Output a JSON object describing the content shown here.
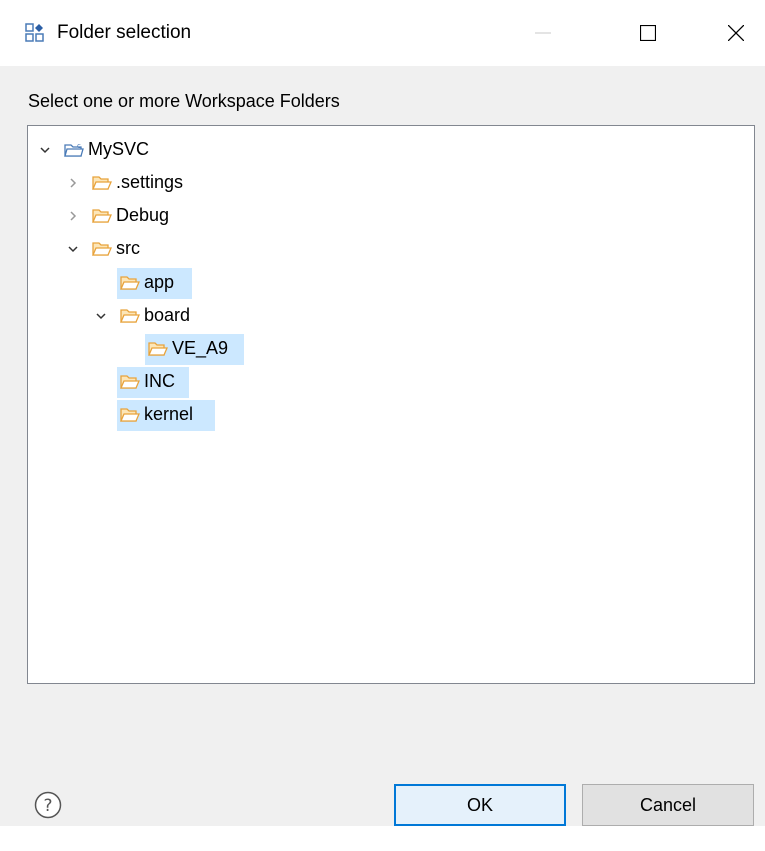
{
  "window": {
    "title": "Folder selection",
    "app_icon": "workspace-icon"
  },
  "prompt": "Select one or more Workspace Folders",
  "tree": {
    "items": [
      {
        "label": "MySVC",
        "expanded": true,
        "icon": "project-folder-icon",
        "selected": false
      },
      {
        "label": ".settings",
        "expanded": false,
        "icon": "folder-icon",
        "selected": false
      },
      {
        "label": "Debug",
        "expanded": false,
        "icon": "folder-icon",
        "selected": false
      },
      {
        "label": "src",
        "expanded": true,
        "icon": "folder-icon",
        "selected": false
      },
      {
        "label": "app",
        "icon": "folder-icon",
        "selected": true
      },
      {
        "label": "board",
        "expanded": true,
        "icon": "folder-icon",
        "selected": false
      },
      {
        "label": "VE_A9",
        "icon": "folder-icon",
        "selected": true
      },
      {
        "label": "INC",
        "icon": "folder-icon",
        "selected": true
      },
      {
        "label": "kernel",
        "icon": "folder-icon",
        "selected": true
      }
    ]
  },
  "buttons": {
    "ok_label": "OK",
    "cancel_label": "Cancel"
  },
  "colors": {
    "selection": "#cce8ff",
    "folder": "#e8a33c",
    "accent": "#0078d7"
  }
}
